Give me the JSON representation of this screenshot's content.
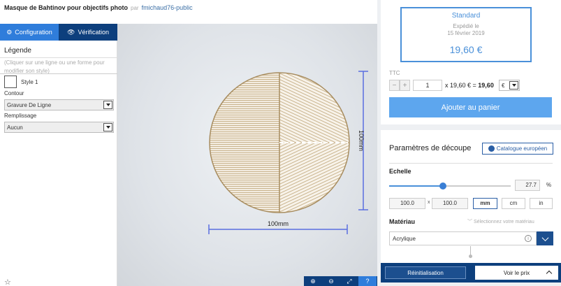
{
  "header": {
    "title": "Masque de Bahtinov pour objectifs photo",
    "par": "par",
    "author": "fmichaud76-public"
  },
  "tabs": [
    {
      "label": "Configuration",
      "icon": "gear-icon"
    },
    {
      "label": "Vérification",
      "icon": "eye-icon"
    }
  ],
  "legend": {
    "title": "Légende",
    "hint": "(Cliquer sur une ligne ou une forme pour modifier son style)",
    "style_name": "Style 1",
    "contour_label": "Contour",
    "contour_value": "Gravure De Ligne",
    "fill_label": "Remplissage",
    "fill_value": "Aucun"
  },
  "canvas": {
    "width_label": "100mm",
    "height_label": "100mm"
  },
  "zoom": {
    "zoom_in": "⊕",
    "zoom_out": "⊖",
    "fit": "⤢",
    "help": "?"
  },
  "offer": {
    "name": "Standard",
    "shipped": "Expédié le",
    "date": "15 février 2019",
    "price": "19,60 €"
  },
  "quantity": {
    "ttc": "TTC",
    "minus": "−",
    "plus": "+",
    "value": "1",
    "calc_prefix": "x 19,60 € = ",
    "calc_total": "19,60",
    "currency": "€"
  },
  "cart": {
    "label": "Ajouter au panier"
  },
  "cut": {
    "title": "Paramètres de découpe",
    "catalog": "Catalogue européen",
    "scale_label": "Echelle",
    "scale_fraction": 0.44,
    "scale_value": "27.7",
    "scale_unit": "%",
    "width": "100.0",
    "times": "x",
    "height": "100.0",
    "units": [
      "mm",
      "cm",
      "in"
    ],
    "material_label": "Matériau",
    "material_hint": "Sélectionnez votre matériau",
    "material_value": "Acrylique",
    "info": "i"
  },
  "footer": {
    "reset": "Réinitialisation",
    "see_price": "Voir le prix"
  },
  "colors": {
    "accent": "#2f7ddb",
    "dark": "#0d3f7d",
    "cart": "#5da6ee",
    "dimension": "#5a6ee0",
    "engrave": "#c9b48e"
  }
}
